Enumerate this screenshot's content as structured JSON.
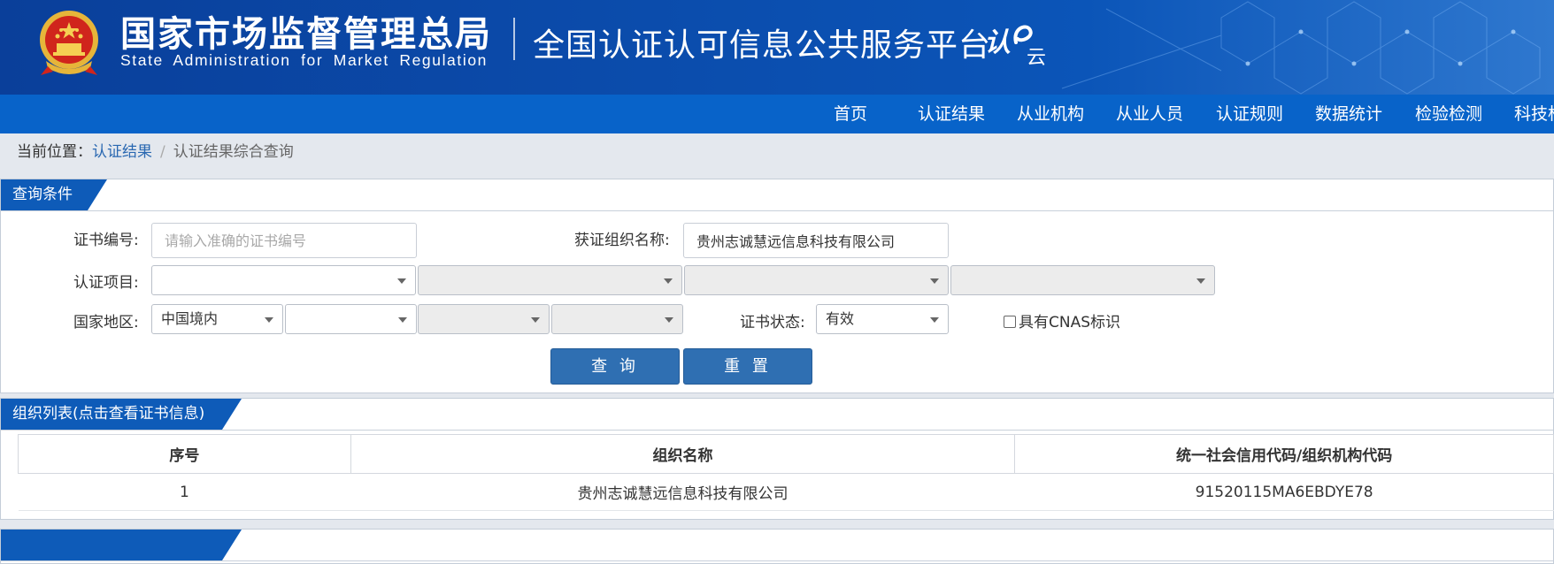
{
  "header": {
    "org_name_cn": "国家市场监督管理总局",
    "org_name_en": "State Administration for Market Regulation",
    "platform_title": "全国认证认可信息公共服务平台",
    "logo_text": "认e云"
  },
  "nav": {
    "items": [
      "首页",
      "认证结果",
      "从业机构",
      "从业人员",
      "认证规则",
      "数据统计",
      "检验检测",
      "科技标准"
    ]
  },
  "breadcrumb": {
    "prefix": "当前位置：",
    "link": "认证结果",
    "separator": "/",
    "current": "认证结果综合查询"
  },
  "query_panel": {
    "title": "查询条件",
    "cert_no_label": "证书编号:",
    "cert_no_placeholder": "请输入准确的证书编号",
    "org_name_label": "获证组织名称:",
    "org_name_value": "贵州志诚慧远信息科技有限公司",
    "project_label": "认证项目:",
    "region_label": "国家地区:",
    "region_value": "中国境内",
    "status_label": "证书状态:",
    "status_value": "有效",
    "cnas_label": "具有CNAS标识",
    "search_button": "查 询",
    "reset_button": "重 置"
  },
  "list_panel": {
    "title": "组织列表(点击查看证书信息)",
    "columns": [
      "序号",
      "组织名称",
      "统一社会信用代码/组织机构代码"
    ],
    "rows": [
      {
        "index": "1",
        "name": "贵州志诚慧远信息科技有限公司",
        "code": "91520115MA6EBDYE78"
      }
    ]
  },
  "colors": {
    "header_bg": "#0b4aa9",
    "nav_bg": "#0863c9",
    "panel_tab_bg": "#0e5bb8",
    "button_bg": "#2f6fb2",
    "link": "#2a68b1"
  }
}
